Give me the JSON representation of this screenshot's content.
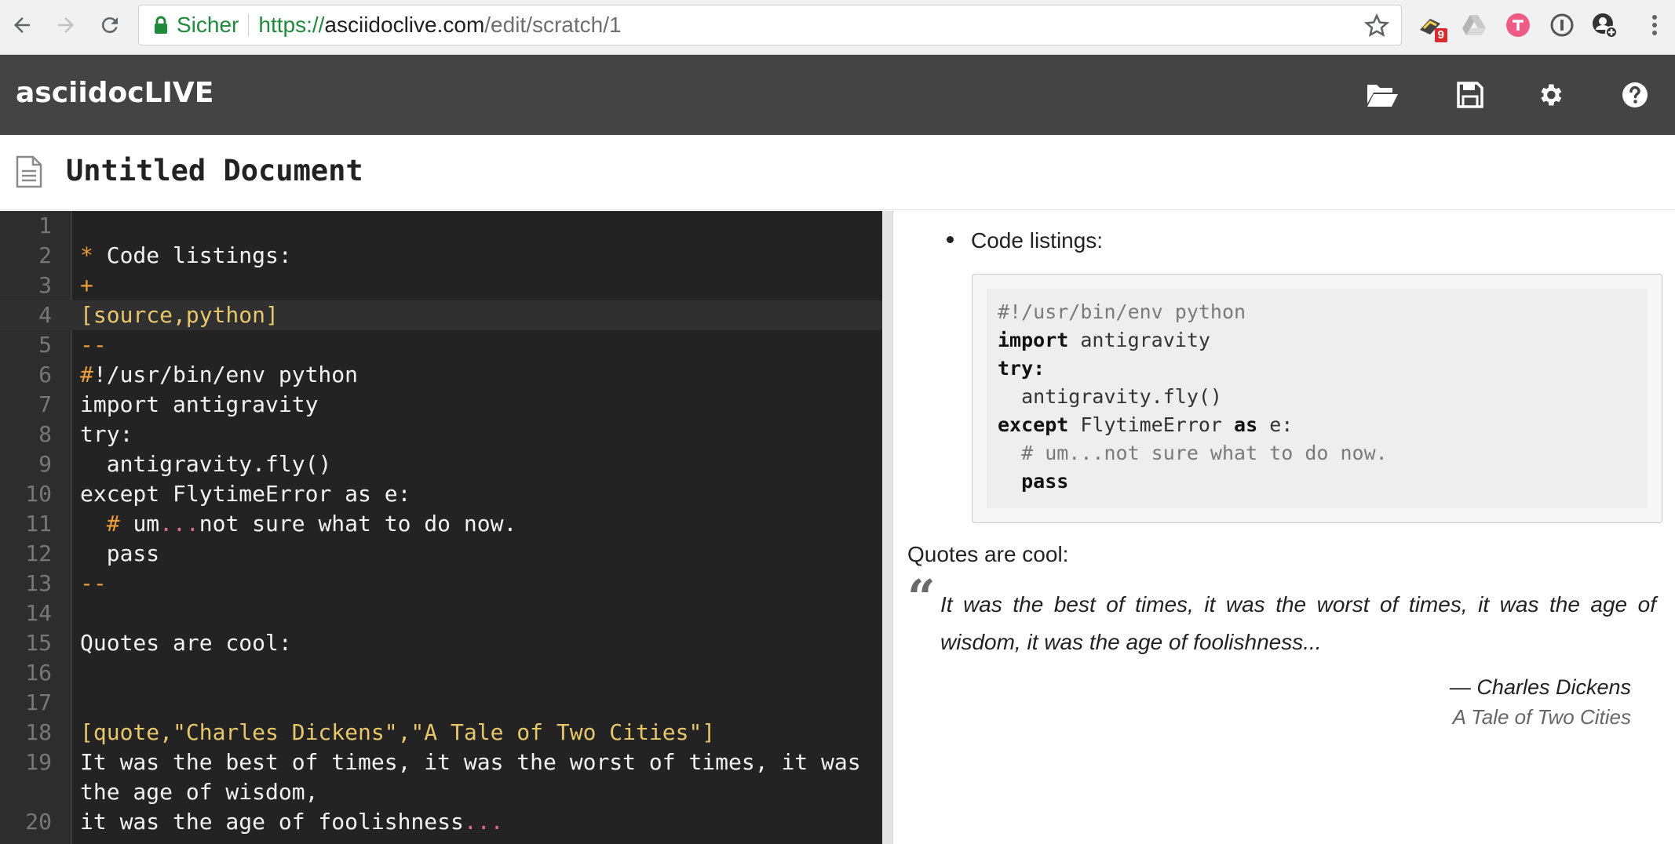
{
  "browser": {
    "secure_label": "Sicher",
    "url_scheme": "https://",
    "url_host": "asciidoclive.com",
    "url_path": "/edit/scratch/1",
    "extension_badge": "9"
  },
  "app": {
    "brand": "asciidocLIVE",
    "toolbar_icons": [
      "folder-open-icon",
      "save-icon",
      "gear-icon",
      "help-icon"
    ]
  },
  "document": {
    "title": "Untitled Document"
  },
  "editor": {
    "lines": [
      {
        "n": "1",
        "text": ""
      },
      {
        "n": "2",
        "prefix": "* ",
        "text": "Code listings:"
      },
      {
        "n": "3",
        "text": "+"
      },
      {
        "n": "4",
        "text": "[source,python]"
      },
      {
        "n": "5",
        "text": "--"
      },
      {
        "n": "6",
        "prefix": "#",
        "text": "!/usr/bin/env python"
      },
      {
        "n": "7",
        "text": "import antigravity"
      },
      {
        "n": "8",
        "text": "try:"
      },
      {
        "n": "9",
        "text": "  antigravity.fly()"
      },
      {
        "n": "10",
        "text": "except FlytimeError as e:"
      },
      {
        "n": "11",
        "prefix": "  # ",
        "text": "um",
        "ellipsis": "...",
        "suffix": "not sure what to do now."
      },
      {
        "n": "12",
        "text": "  pass"
      },
      {
        "n": "13",
        "text": "--"
      },
      {
        "n": "14",
        "text": ""
      },
      {
        "n": "15",
        "text": "Quotes are cool:"
      },
      {
        "n": "16",
        "text": ""
      },
      {
        "n": "17",
        "text": ""
      },
      {
        "n": "18",
        "text": "[quote,\"Charles Dickens\",\"A Tale of Two Cities\"]"
      },
      {
        "n": "19",
        "text": "It was the best of times, it was the worst of times, it was the age of wisdom,"
      },
      {
        "n": "20",
        "text": "it was the age of foolishness",
        "ellipsis": "..."
      }
    ]
  },
  "preview": {
    "list_item": "Code listings:",
    "code": {
      "shebang": "#!/usr/bin/env python",
      "import_kw": "import",
      "import_rest": " antigravity",
      "try_kw": "try:",
      "call": "  antigravity.fly()",
      "except_kw": "except",
      "except_mid": " FlytimeError ",
      "as_kw": "as",
      "except_end": " e:",
      "comment": "  # um...not sure what to do now.",
      "pass_kw": "pass"
    },
    "quotes_label": "Quotes are cool:",
    "quote_text": "It was the best of times, it was the worst of times, it was the age of wisdom, it was the age of foolishness...",
    "attribution_author": "— Charles Dickens",
    "attribution_cite": "A Tale of Two Cities"
  }
}
